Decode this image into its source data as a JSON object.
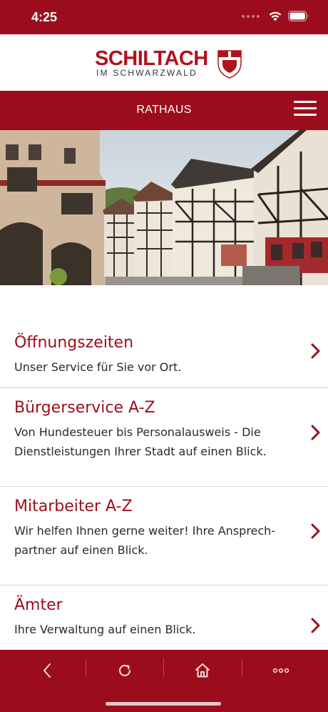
{
  "status_bar": {
    "time": "4:25"
  },
  "logo": {
    "main": "SCHILTACH",
    "sub": "IM SCHWARZWALD"
  },
  "header": {
    "title": "RATHAUS"
  },
  "items": [
    {
      "title": "Öffnungszeiten",
      "desc_lines": [
        "Unser Service für Sie vor Ort."
      ]
    },
    {
      "title": "Bürgerservice A-Z",
      "desc_lines": [
        "Von Hundesteuer bis Personalausweis - Die",
        "Dienstleistungen Ihrer Stadt auf einen Blick."
      ]
    },
    {
      "title": "Mitarbeiter A-Z",
      "desc_lines": [
        "Wir helfen Ihnen gerne weiter! Ihre Ansprech-",
        "partner auf einen Blick."
      ]
    },
    {
      "title": "Ämter",
      "desc_lines": [
        "Ihre Verwaltung auf einen Blick."
      ]
    }
  ],
  "bottom_nav": [
    "back-icon",
    "reload-icon",
    "home-icon",
    "more-icon"
  ],
  "colors": {
    "brand": "#9b0d1c",
    "logo_red": "#b0121f"
  }
}
